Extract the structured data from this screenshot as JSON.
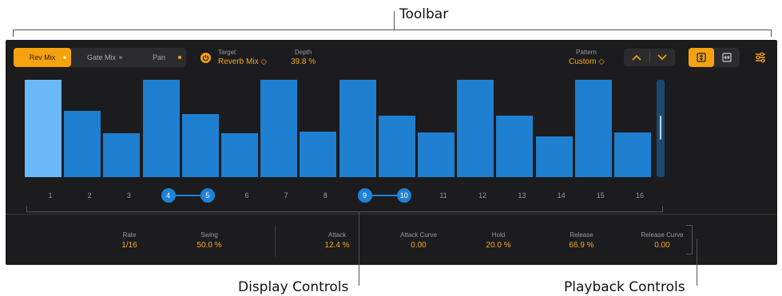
{
  "callouts": {
    "toolbar": "Toolbar",
    "display_controls": "Display Controls",
    "playback_controls": "Playback Controls"
  },
  "toolbar": {
    "mix_tabs": [
      {
        "label": "Rev Mix",
        "active": true
      },
      {
        "label": "Gate Mix",
        "active": false
      },
      {
        "label": "Pan",
        "active": false
      }
    ],
    "target": {
      "label": "Target",
      "value": "Reverb Mix ◇"
    },
    "depth": {
      "label": "Depth",
      "value": "39.8 %"
    },
    "pattern": {
      "label": "Pattern",
      "value": "Custom ◇"
    },
    "nav_icons": [
      "chevron-up-icon",
      "chevron-down-icon"
    ],
    "view_icons": [
      "vertical-resize-icon",
      "horizontal-resize-icon"
    ],
    "settings_icon": "sliders-icon"
  },
  "steps": {
    "bar_levels": [
      1.0,
      0.68,
      0.45,
      1.0,
      0.65,
      0.45,
      1.0,
      0.47,
      1.0,
      0.63,
      0.46,
      1.0,
      0.63,
      0.42,
      1.0,
      0.46
    ],
    "highlighted_step": 1,
    "labels": [
      "1",
      "2",
      "3",
      "4",
      "5",
      "6",
      "7",
      "8",
      "9",
      "10",
      "11",
      "12",
      "13",
      "14",
      "15",
      "16"
    ],
    "linked_pairs": [
      [
        4,
        5
      ],
      [
        9,
        10
      ]
    ]
  },
  "colors": {
    "accent_orange": "#f4a30f",
    "bar_blue": "#1f7fd0",
    "bar_highlight": "#6ab8f8",
    "panel_bg": "#1c1c1e"
  },
  "params": [
    {
      "label": "Rate",
      "value": "1/16"
    },
    {
      "label": "Swing",
      "value": "50.0 %"
    },
    {
      "label": "Attack",
      "value": "12.4 %"
    },
    {
      "label": "Attack Curve",
      "value": "0.00"
    },
    {
      "label": "Hold",
      "value": "20.0 %"
    },
    {
      "label": "Release",
      "value": "66.9 %"
    },
    {
      "label": "Release Curve",
      "value": "0.00"
    }
  ]
}
